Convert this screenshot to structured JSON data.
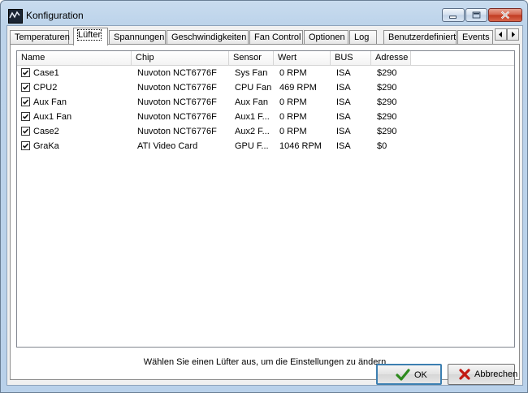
{
  "window": {
    "title": "Konfiguration",
    "icon": "app-monitor-icon"
  },
  "tabs": [
    {
      "label": "Temperaturen",
      "active": false
    },
    {
      "label": "Lüfter",
      "active": true
    },
    {
      "label": "Spannungen",
      "active": false
    },
    {
      "label": "Geschwindigkeiten",
      "active": false
    },
    {
      "label": "Fan Control",
      "active": false
    },
    {
      "label": "Optionen",
      "active": false
    },
    {
      "label": "Log",
      "active": false
    },
    {
      "label": "Benutzerdefiniert",
      "active": false
    },
    {
      "label": "Events",
      "active": false
    }
  ],
  "fan_list": {
    "columns": [
      "Name",
      "Chip",
      "Sensor",
      "Wert",
      "BUS",
      "Adresse"
    ],
    "rows": [
      {
        "checked": true,
        "name": "Case1",
        "chip": "Nuvoton NCT6776F",
        "sensor": "Sys Fan",
        "value": "0 RPM",
        "bus": "ISA",
        "address": "$290"
      },
      {
        "checked": true,
        "name": "CPU2",
        "chip": "Nuvoton NCT6776F",
        "sensor": "CPU Fan",
        "value": "469 RPM",
        "bus": "ISA",
        "address": "$290"
      },
      {
        "checked": true,
        "name": "Aux Fan",
        "chip": "Nuvoton NCT6776F",
        "sensor": "Aux Fan",
        "value": "0 RPM",
        "bus": "ISA",
        "address": "$290"
      },
      {
        "checked": true,
        "name": "Aux1 Fan",
        "chip": "Nuvoton NCT6776F",
        "sensor": "Aux1 F...",
        "value": "0 RPM",
        "bus": "ISA",
        "address": "$290"
      },
      {
        "checked": true,
        "name": "Case2",
        "chip": "Nuvoton NCT6776F",
        "sensor": "Aux2 F...",
        "value": "0 RPM",
        "bus": "ISA",
        "address": "$290"
      },
      {
        "checked": true,
        "name": "GraKa",
        "chip": "ATI Video Card",
        "sensor": "GPU F...",
        "value": "1046 RPM",
        "bus": "ISA",
        "address": "$0"
      }
    ]
  },
  "hint": "Wählen Sie einen Lüfter aus, um die Einstellungen zu ändern",
  "buttons": {
    "ok": "OK",
    "cancel": "Abbrechen"
  }
}
